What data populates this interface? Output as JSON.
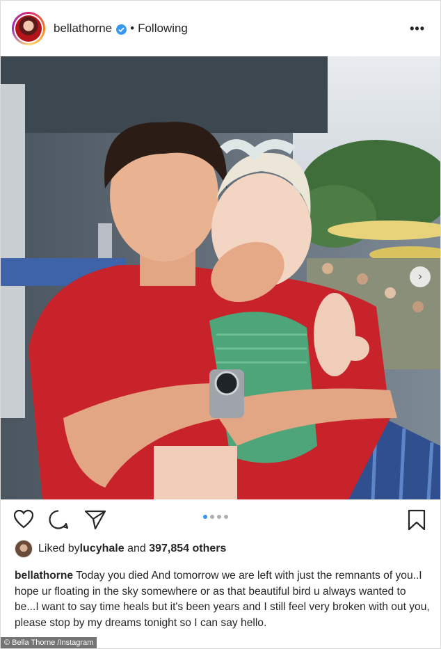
{
  "header": {
    "username": "bellathorne",
    "separator": "•",
    "follow_status": "Following",
    "more_label": "•••"
  },
  "photo": {
    "carousel": {
      "current_index": 1,
      "total": 4
    },
    "next_arrow": "›"
  },
  "actions": {
    "icons": [
      "heart-icon",
      "comment-icon",
      "share-icon",
      "bookmark-icon"
    ]
  },
  "likes": {
    "prefix": "Liked by ",
    "user": "lucyhale",
    "middle": " and ",
    "others": "397,854 others"
  },
  "caption": {
    "username": "bellathorne",
    "text": " Today you died And tomorrow we are left with just the remnants of you..I hope ur floating in the sky somewhere or as that beautiful bird u always wanted to be...I want to say time heals but it's been years and I still feel very broken with out you, please stop by my dreams tonight so I can say hello."
  },
  "watermark": "© Bella Thorne /Instagram",
  "colors": {
    "accent": "#3897f0",
    "text": "#262626",
    "shirt": "#c8232a",
    "romper": "#4fa57a"
  }
}
